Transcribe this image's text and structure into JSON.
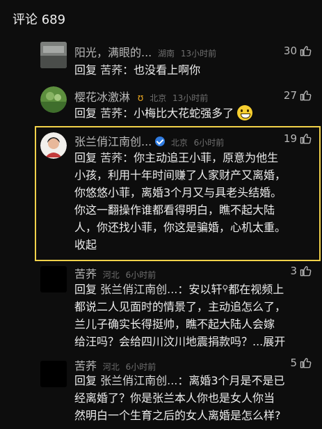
{
  "header": {
    "title": "评论 689"
  },
  "comments": [
    {
      "username": "阳光，满眼的...",
      "location": "湖南",
      "time": "13小时前",
      "likes": "30",
      "reply_prefix": "回复",
      "mention": "苦荞",
      "text": "：也没看上啊你"
    },
    {
      "username": "樱花冰激淋",
      "location": "北京",
      "time": "13小时前",
      "likes": "27",
      "reply_prefix": "回复",
      "mention": "苦荞",
      "text": "：小梅比大花蛇强多了"
    },
    {
      "username": "张兰俏江南创...",
      "location": "北京",
      "time": "6小时前",
      "likes": "19",
      "reply_prefix": "回复",
      "mention": "苦荞",
      "lines": [
        "：你主动追王小菲，原意为他生",
        "小孩，利用十年时间赚了人家财产又离婚，",
        "你悠悠小菲，离婚3个月又与具老头结婚。",
        "你这一翻操作谁都看得明白，瞧不起大陆",
        "人，你还找小菲，你这是骗婚，心机太重。"
      ],
      "collapse": "收起"
    },
    {
      "username": "苦荞",
      "location": "河北",
      "time": "6小时前",
      "likes": "3",
      "reply_prefix": "回复",
      "mention": "张兰俏江南创...",
      "lines_a": "：安以轩",
      "lines_b": "都在视频上",
      "lines": [
        "都说二人见面时的情景了，主动追怎么了，",
        "兰儿子确实长得挺帅，瞧不起大陆人会嫁",
        "给汪吗？会给四川汶川地震捐款吗？..."
      ],
      "expand": "展开"
    },
    {
      "username": "苦荞",
      "location": "河北",
      "time": "6小时前",
      "likes": "5",
      "reply_prefix": "回复",
      "mention": "张兰俏江南创...",
      "lines": [
        "：离婚3个月是不是已",
        "经离婚了？你是张兰本人你也是女人你当",
        "然明白一个生育之后的女人离婚是怎么样?"
      ]
    }
  ]
}
